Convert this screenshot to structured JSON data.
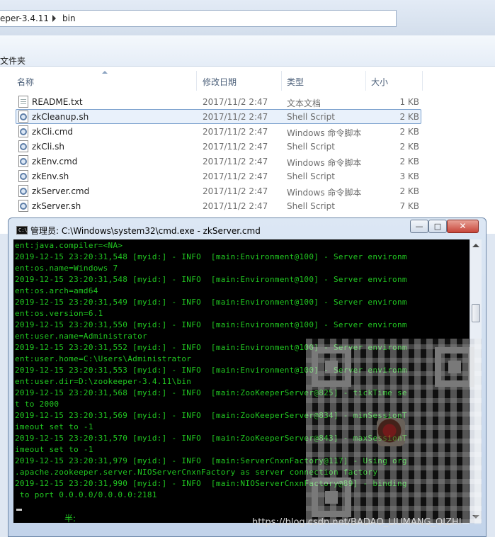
{
  "explorer": {
    "breadcrumb": [
      "eper-3.4.11",
      "bin"
    ],
    "toolbar_label": "文件夹",
    "columns": {
      "name": "名称",
      "modified": "修改日期",
      "type": "类型",
      "size": "大小"
    },
    "files": [
      {
        "name": "README.txt",
        "modified": "2017/11/2 2:47",
        "type": "文本文档",
        "size": "1 KB",
        "icon": "text-file-icon"
      },
      {
        "name": "zkCleanup.sh",
        "modified": "2017/11/2 2:47",
        "type": "Shell Script",
        "size": "2 KB",
        "icon": "script-file-icon"
      },
      {
        "name": "zkCli.cmd",
        "modified": "2017/11/2 2:47",
        "type": "Windows 命令脚本",
        "size": "2 KB",
        "icon": "script-file-icon"
      },
      {
        "name": "zkCli.sh",
        "modified": "2017/11/2 2:47",
        "type": "Shell Script",
        "size": "2 KB",
        "icon": "script-file-icon"
      },
      {
        "name": "zkEnv.cmd",
        "modified": "2017/11/2 2:47",
        "type": "Windows 命令脚本",
        "size": "2 KB",
        "icon": "script-file-icon"
      },
      {
        "name": "zkEnv.sh",
        "modified": "2017/11/2 2:47",
        "type": "Shell Script",
        "size": "3 KB",
        "icon": "script-file-icon"
      },
      {
        "name": "zkServer.cmd",
        "modified": "2017/11/2 2:47",
        "type": "Windows 命令脚本",
        "size": "2 KB",
        "icon": "script-file-icon"
      },
      {
        "name": "zkServer.sh",
        "modified": "2017/11/2 2:47",
        "type": "Shell Script",
        "size": "7 KB",
        "icon": "script-file-icon"
      }
    ]
  },
  "cmd": {
    "title": "管理员: C:\\Windows\\system32\\cmd.exe - zkServer.cmd",
    "icon_text": "C:\\",
    "buttons": {
      "minimize": "—",
      "maximize": "□",
      "close": "✕"
    },
    "lines": [
      "ent:java.compiler=<NA>",
      "2019-12-15 23:20:31,548 [myid:] - INFO  [main:Environment@100] - Server environm",
      "ent:os.name=Windows 7",
      "2019-12-15 23:20:31,548 [myid:] - INFO  [main:Environment@100] - Server environm",
      "ent:os.arch=amd64",
      "2019-12-15 23:20:31,549 [myid:] - INFO  [main:Environment@100] - Server environm",
      "ent:os.version=6.1",
      "2019-12-15 23:20:31,550 [myid:] - INFO  [main:Environment@100] - Server environm",
      "ent:user.name=Administrator",
      "2019-12-15 23:20:31,552 [myid:] - INFO  [main:Environment@100] - Server environm",
      "ent:user.home=C:\\Users\\Administrator",
      "2019-12-15 23:20:31,553 [myid:] - INFO  [main:Environment@100] - Server environm",
      "ent:user.dir=D:\\zookeeper-3.4.11\\bin",
      "2019-12-15 23:20:31,568 [myid:] - INFO  [main:ZooKeeperServer@825] - tickTime se",
      "t to 2000",
      "2019-12-15 23:20:31,569 [myid:] - INFO  [main:ZooKeeperServer@834] - minSessionT",
      "imeout set to -1",
      "2019-12-15 23:20:31,570 [myid:] - INFO  [main:ZooKeeperServer@843] - maxSessionT",
      "imeout set to -1",
      "2019-12-15 23:20:31,979 [myid:] - INFO  [main:ServerCnxnFactory@117] - Using org",
      ".apache.zookeeper.server.NIOServerCnxnFactory as server connection factory",
      "2019-12-15 23:20:31,990 [myid:] - INFO  [main:NIOServerCnxnFactory@89] - binding",
      " to port 0.0.0.0/0.0.0.0:2181"
    ],
    "ime_text": "半:"
  },
  "watermark": "https://blog.csdn.net/BADAO_LIUMANG_QIZHI",
  "colors": {
    "console_bg": "#000000",
    "console_text": "#21c821",
    "selection": "#e9f1fb"
  }
}
